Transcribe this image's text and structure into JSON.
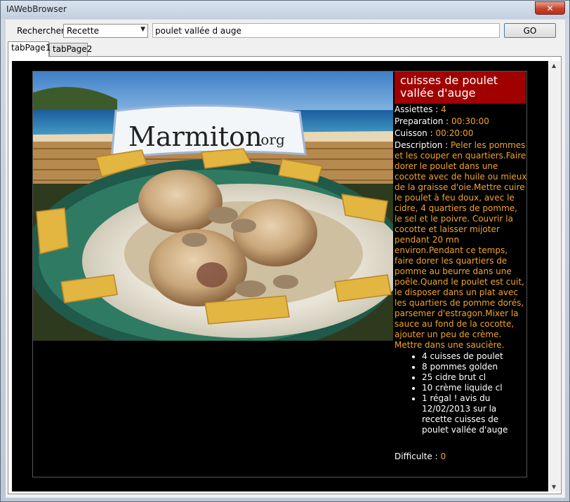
{
  "window": {
    "title": "IAWebBrowser",
    "close_label": "✕"
  },
  "search": {
    "label": "Rechercher",
    "category_selected": "Recette",
    "query": "poulet vallée d auge",
    "go_label": "GO"
  },
  "tabs": [
    {
      "label": "tabPage1",
      "active": true
    },
    {
      "label": "tabPage2",
      "active": false
    }
  ],
  "recipe": {
    "photo_brand": "Marmiton",
    "photo_brand_suffix": ".org",
    "title": "cuisses de poulet vallée d'auge",
    "assiettes_label": "Assiettes : ",
    "assiettes_value": "4",
    "preparation_label": "Preparation : ",
    "preparation_value": "00:30:00",
    "cuisson_label": "Cuisson : ",
    "cuisson_value": "00:20:00",
    "description_label": "Description : ",
    "description_value": "Peler les pommes et les couper en quartiers.Faire dorer le poulet dans une cocotte avec de huile ou mieux de la graisse d'oie.Mettre cuire le poulet à feu doux, avec le cidre, 4 quartiers de pomme, le sel et le poivre. Couvrir la cocotte et laisser mijoter pendant 20 mn environ.Pendant ce temps, faire dorer les quartiers de pomme au beurre dans une poêle.Quand le poulet est cuit, le disposer dans un plat avec les quartiers de pomme dorés, parsemer d'estragon.Mixer la sauce au fond de la cocotte, ajouter un peu de crème. Mettre dans une saucière.",
    "ingredients": [
      "4 cuisses de poulet",
      "8 pommes golden",
      "25 cidre brut cl",
      "10 crème liquide cl",
      "1 régal ! avis du 12/02/2013 sur la recette cuisses de poulet vallée d'auge"
    ],
    "difficulte_label": "Difficulte : ",
    "difficulte_value": "0"
  },
  "colors": {
    "title_bg": "#a00000",
    "value_text": "#f3a425",
    "browser_bg": "#000000"
  }
}
